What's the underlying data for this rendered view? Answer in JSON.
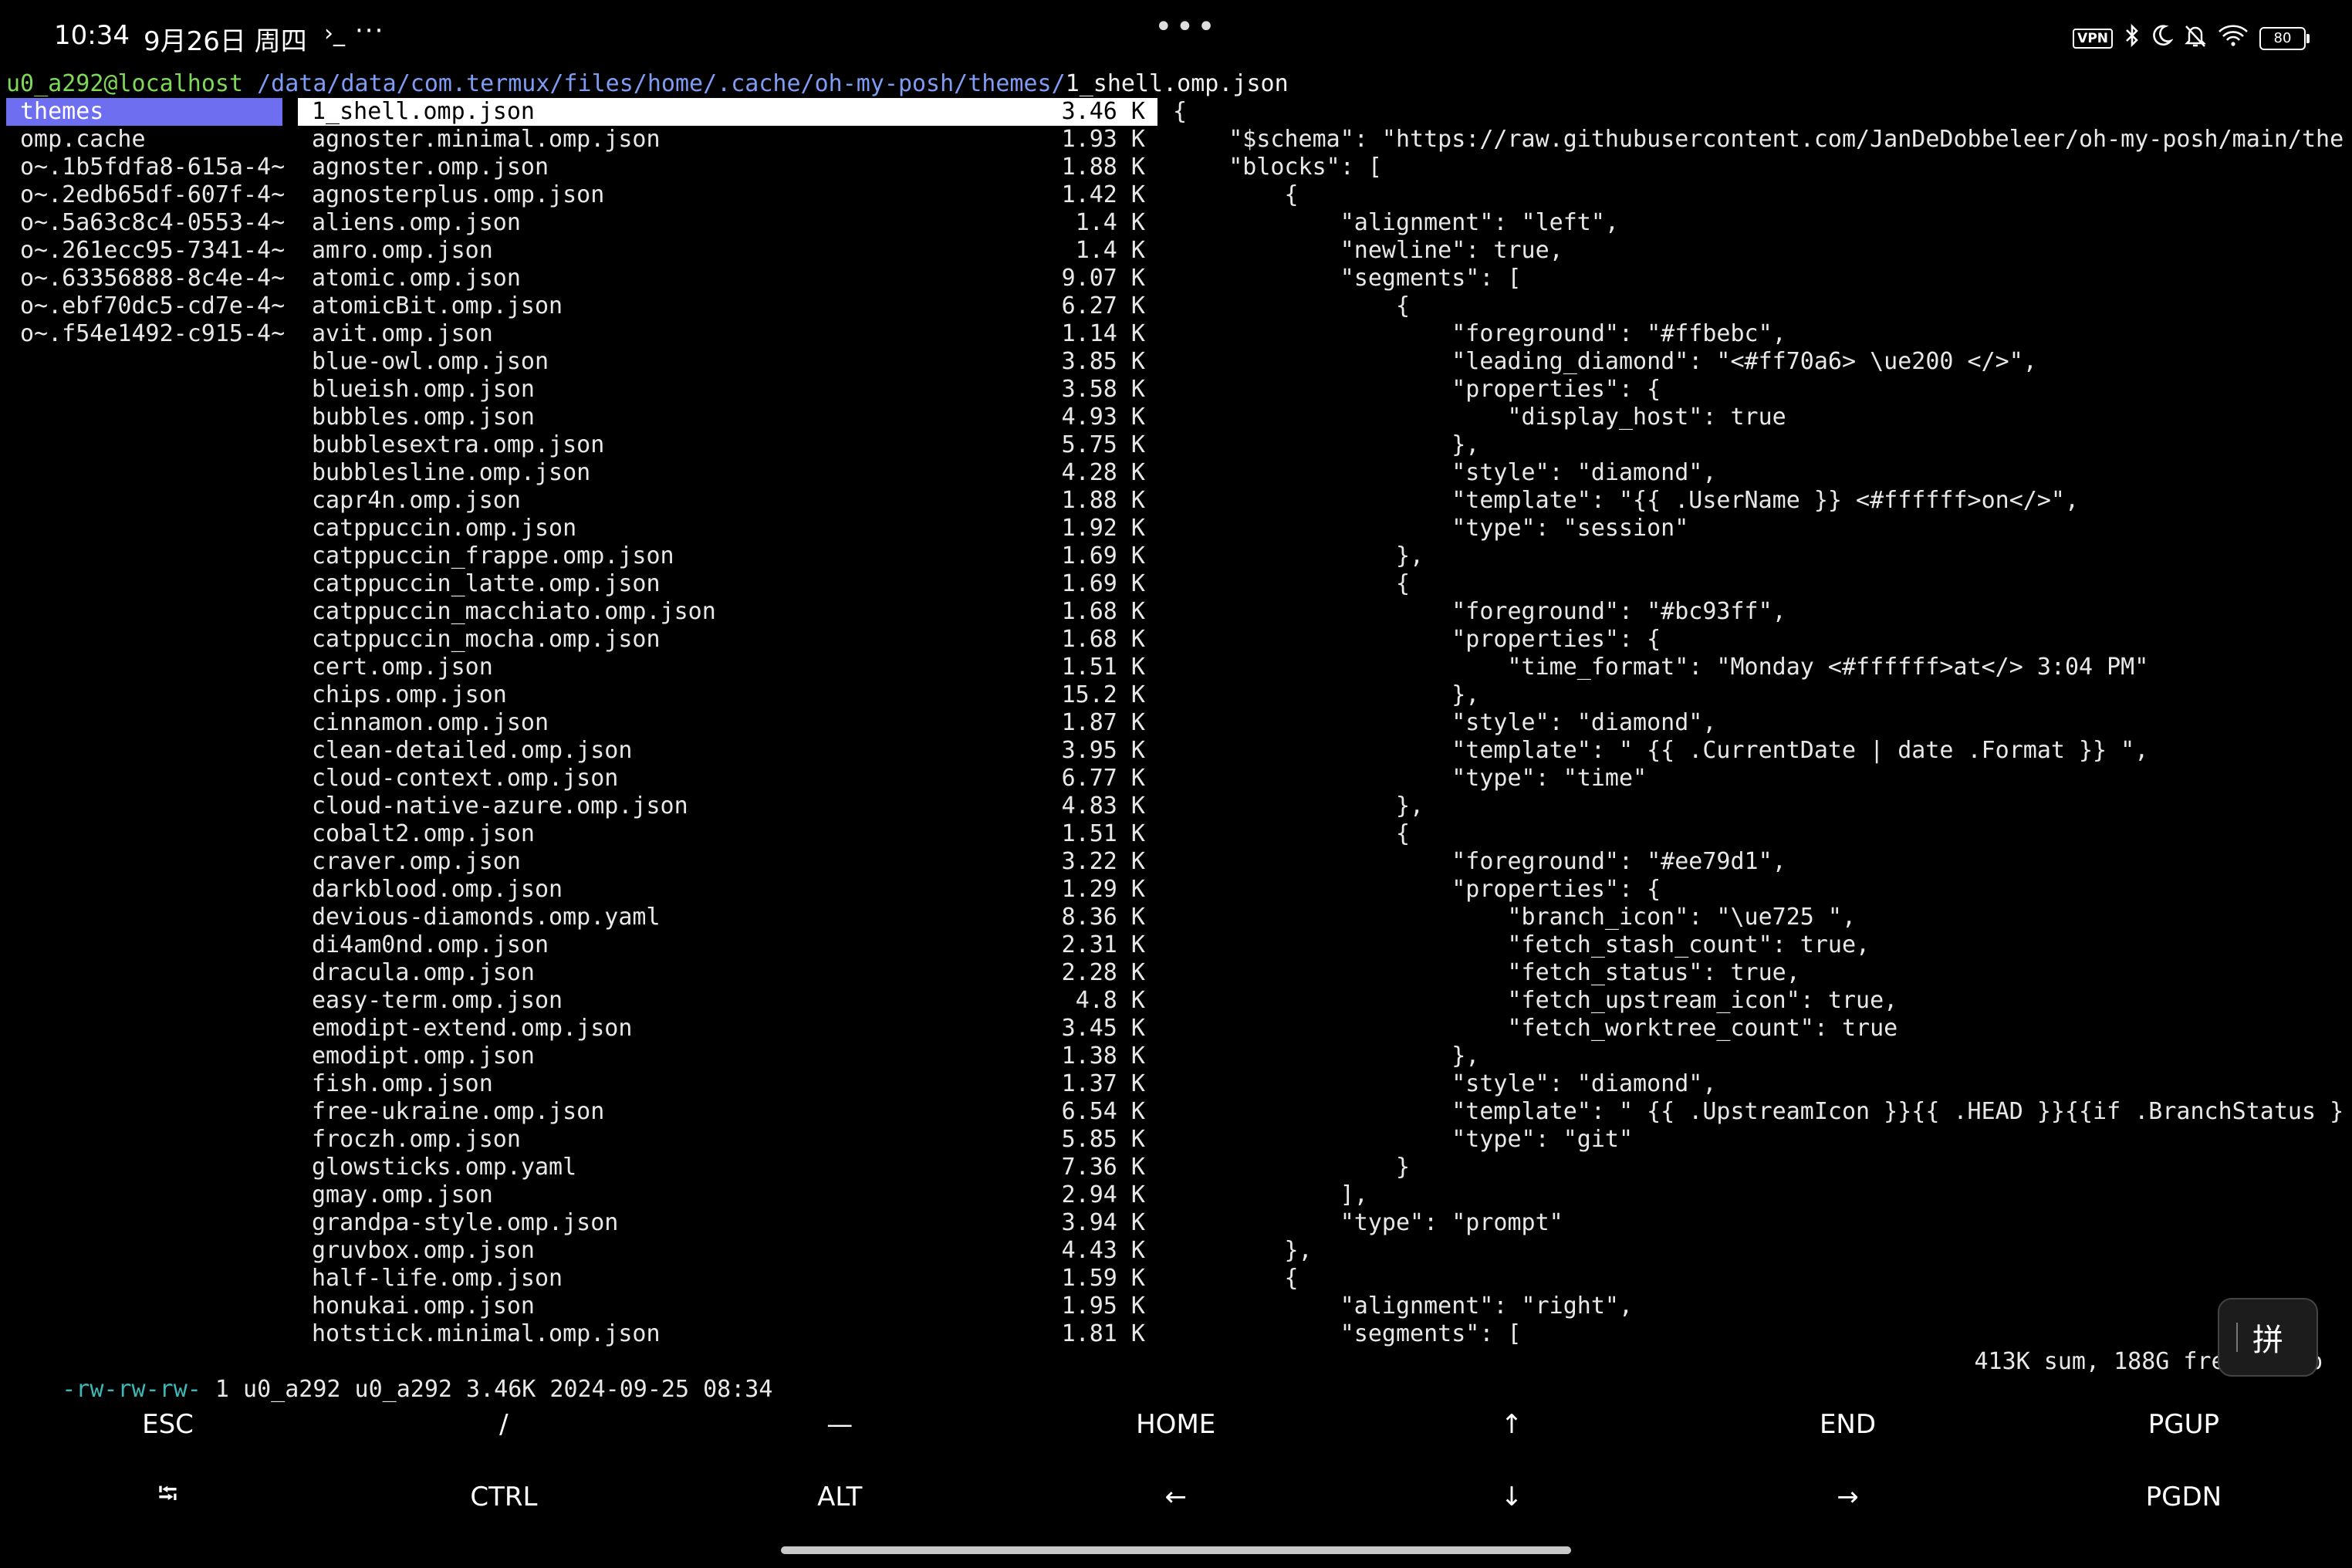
{
  "status_bar": {
    "time": "10:34",
    "date": "9月26日 周四",
    "terminal_glyph": "›_",
    "more": "···",
    "center_dots": "•••",
    "vpn": "VPN",
    "battery": "80",
    "icons": [
      "vpn-icon",
      "bluetooth-icon",
      "moon-icon",
      "bell-off-icon",
      "wifi-icon",
      "battery-icon"
    ]
  },
  "path": {
    "user_host": "u0_a292@localhost",
    "dir": " /data/data/com.termux/files/home/.cache/oh-my-posh/themes/",
    "file": "1_shell.omp.json"
  },
  "parent_column": [
    "themes",
    "omp.cache",
    "o~.1b5fdfa8-615a-4~",
    "o~.2edb65df-607f-4~",
    "o~.5a63c8c4-0553-4~",
    "o~.261ecc95-7341-4~",
    "o~.63356888-8c4e-4~",
    "o~.ebf70dc5-cd7e-4~",
    "o~.f54e1492-c915-4~"
  ],
  "files": [
    {
      "name": "1_shell.omp.json",
      "size": "3.46 K"
    },
    {
      "name": "agnoster.minimal.omp.json",
      "size": "1.93 K"
    },
    {
      "name": "agnoster.omp.json",
      "size": "1.88 K"
    },
    {
      "name": "agnosterplus.omp.json",
      "size": "1.42 K"
    },
    {
      "name": "aliens.omp.json",
      "size": "1.4 K"
    },
    {
      "name": "amro.omp.json",
      "size": "1.4 K"
    },
    {
      "name": "atomic.omp.json",
      "size": "9.07 K"
    },
    {
      "name": "atomicBit.omp.json",
      "size": "6.27 K"
    },
    {
      "name": "avit.omp.json",
      "size": "1.14 K"
    },
    {
      "name": "blue-owl.omp.json",
      "size": "3.85 K"
    },
    {
      "name": "blueish.omp.json",
      "size": "3.58 K"
    },
    {
      "name": "bubbles.omp.json",
      "size": "4.93 K"
    },
    {
      "name": "bubblesextra.omp.json",
      "size": "5.75 K"
    },
    {
      "name": "bubblesline.omp.json",
      "size": "4.28 K"
    },
    {
      "name": "capr4n.omp.json",
      "size": "1.88 K"
    },
    {
      "name": "catppuccin.omp.json",
      "size": "1.92 K"
    },
    {
      "name": "catppuccin_frappe.omp.json",
      "size": "1.69 K"
    },
    {
      "name": "catppuccin_latte.omp.json",
      "size": "1.69 K"
    },
    {
      "name": "catppuccin_macchiato.omp.json",
      "size": "1.68 K"
    },
    {
      "name": "catppuccin_mocha.omp.json",
      "size": "1.68 K"
    },
    {
      "name": "cert.omp.json",
      "size": "1.51 K"
    },
    {
      "name": "chips.omp.json",
      "size": "15.2 K"
    },
    {
      "name": "cinnamon.omp.json",
      "size": "1.87 K"
    },
    {
      "name": "clean-detailed.omp.json",
      "size": "3.95 K"
    },
    {
      "name": "cloud-context.omp.json",
      "size": "6.77 K"
    },
    {
      "name": "cloud-native-azure.omp.json",
      "size": "4.83 K"
    },
    {
      "name": "cobalt2.omp.json",
      "size": "1.51 K"
    },
    {
      "name": "craver.omp.json",
      "size": "3.22 K"
    },
    {
      "name": "darkblood.omp.json",
      "size": "1.29 K"
    },
    {
      "name": "devious-diamonds.omp.yaml",
      "size": "8.36 K"
    },
    {
      "name": "di4am0nd.omp.json",
      "size": "2.31 K"
    },
    {
      "name": "dracula.omp.json",
      "size": "2.28 K"
    },
    {
      "name": "easy-term.omp.json",
      "size": "4.8 K"
    },
    {
      "name": "emodipt-extend.omp.json",
      "size": "3.45 K"
    },
    {
      "name": "emodipt.omp.json",
      "size": "1.38 K"
    },
    {
      "name": "fish.omp.json",
      "size": "1.37 K"
    },
    {
      "name": "free-ukraine.omp.json",
      "size": "6.54 K"
    },
    {
      "name": "froczh.omp.json",
      "size": "5.85 K"
    },
    {
      "name": "glowsticks.omp.yaml",
      "size": "7.36 K"
    },
    {
      "name": "gmay.omp.json",
      "size": "2.94 K"
    },
    {
      "name": "grandpa-style.omp.json",
      "size": "3.94 K"
    },
    {
      "name": "gruvbox.omp.json",
      "size": "4.43 K"
    },
    {
      "name": "half-life.omp.json",
      "size": "1.59 K"
    },
    {
      "name": "honukai.omp.json",
      "size": "1.95 K"
    },
    {
      "name": "hotstick.minimal.omp.json",
      "size": "1.81 K"
    }
  ],
  "preview_lines": [
    "{",
    "    \"$schema\": \"https://raw.githubusercontent.com/JanDeDobbeleer/oh-my-posh/main/the",
    "    \"blocks\": [",
    "        {",
    "            \"alignment\": \"left\",",
    "            \"newline\": true,",
    "            \"segments\": [",
    "                {",
    "                    \"foreground\": \"#ffbebc\",",
    "                    \"leading_diamond\": \"<#ff70a6> \\ue200 </>\",",
    "                    \"properties\": {",
    "                        \"display_host\": true",
    "                    },",
    "                    \"style\": \"diamond\",",
    "                    \"template\": \"{{ .UserName }} <#ffffff>on</>\",",
    "                    \"type\": \"session\"",
    "                },",
    "                {",
    "                    \"foreground\": \"#bc93ff\",",
    "                    \"properties\": {",
    "                        \"time_format\": \"Monday <#ffffff>at</> 3:04 PM\"",
    "                    },",
    "                    \"style\": \"diamond\",",
    "                    \"template\": \" {{ .CurrentDate | date .Format }} \",",
    "                    \"type\": \"time\"",
    "                },",
    "                {",
    "                    \"foreground\": \"#ee79d1\",",
    "                    \"properties\": {",
    "                        \"branch_icon\": \"\\ue725 \",",
    "                        \"fetch_stash_count\": true,",
    "                        \"fetch_status\": true,",
    "                        \"fetch_upstream_icon\": true,",
    "                        \"fetch_worktree_count\": true",
    "                    },",
    "                    \"style\": \"diamond\",",
    "                    \"template\": \" {{ .UpstreamIcon }}{{ .HEAD }}{{if .BranchStatus }",
    "                    \"type\": \"git\"",
    "                }",
    "            ],",
    "            \"type\": \"prompt\"",
    "        },",
    "        {",
    "            \"alignment\": \"right\",",
    "            \"segments\": ["
  ],
  "status_line": {
    "permissions": "-rw-rw-rw-",
    "details": " 1 u0_a292 u0_a292 3.46K 2024-09-25 08:34",
    "summary": "413K sum, 188G free  1/",
    "tail": "op"
  },
  "extra_keys": {
    "row1": [
      "ESC",
      "/",
      "—",
      "HOME",
      "↑",
      "END",
      "PGUP"
    ],
    "row2": [
      "⭾",
      "CTRL",
      "ALT",
      "←",
      "↓",
      "→",
      "PGDN"
    ]
  },
  "ime_label": "拼",
  "colors": {
    "user_host": "#7ed957",
    "path": "#7f9cf5",
    "selection_parent": "#6e6ef0",
    "selection_file": "#ffffff",
    "permissions": "#3cb8b8"
  }
}
